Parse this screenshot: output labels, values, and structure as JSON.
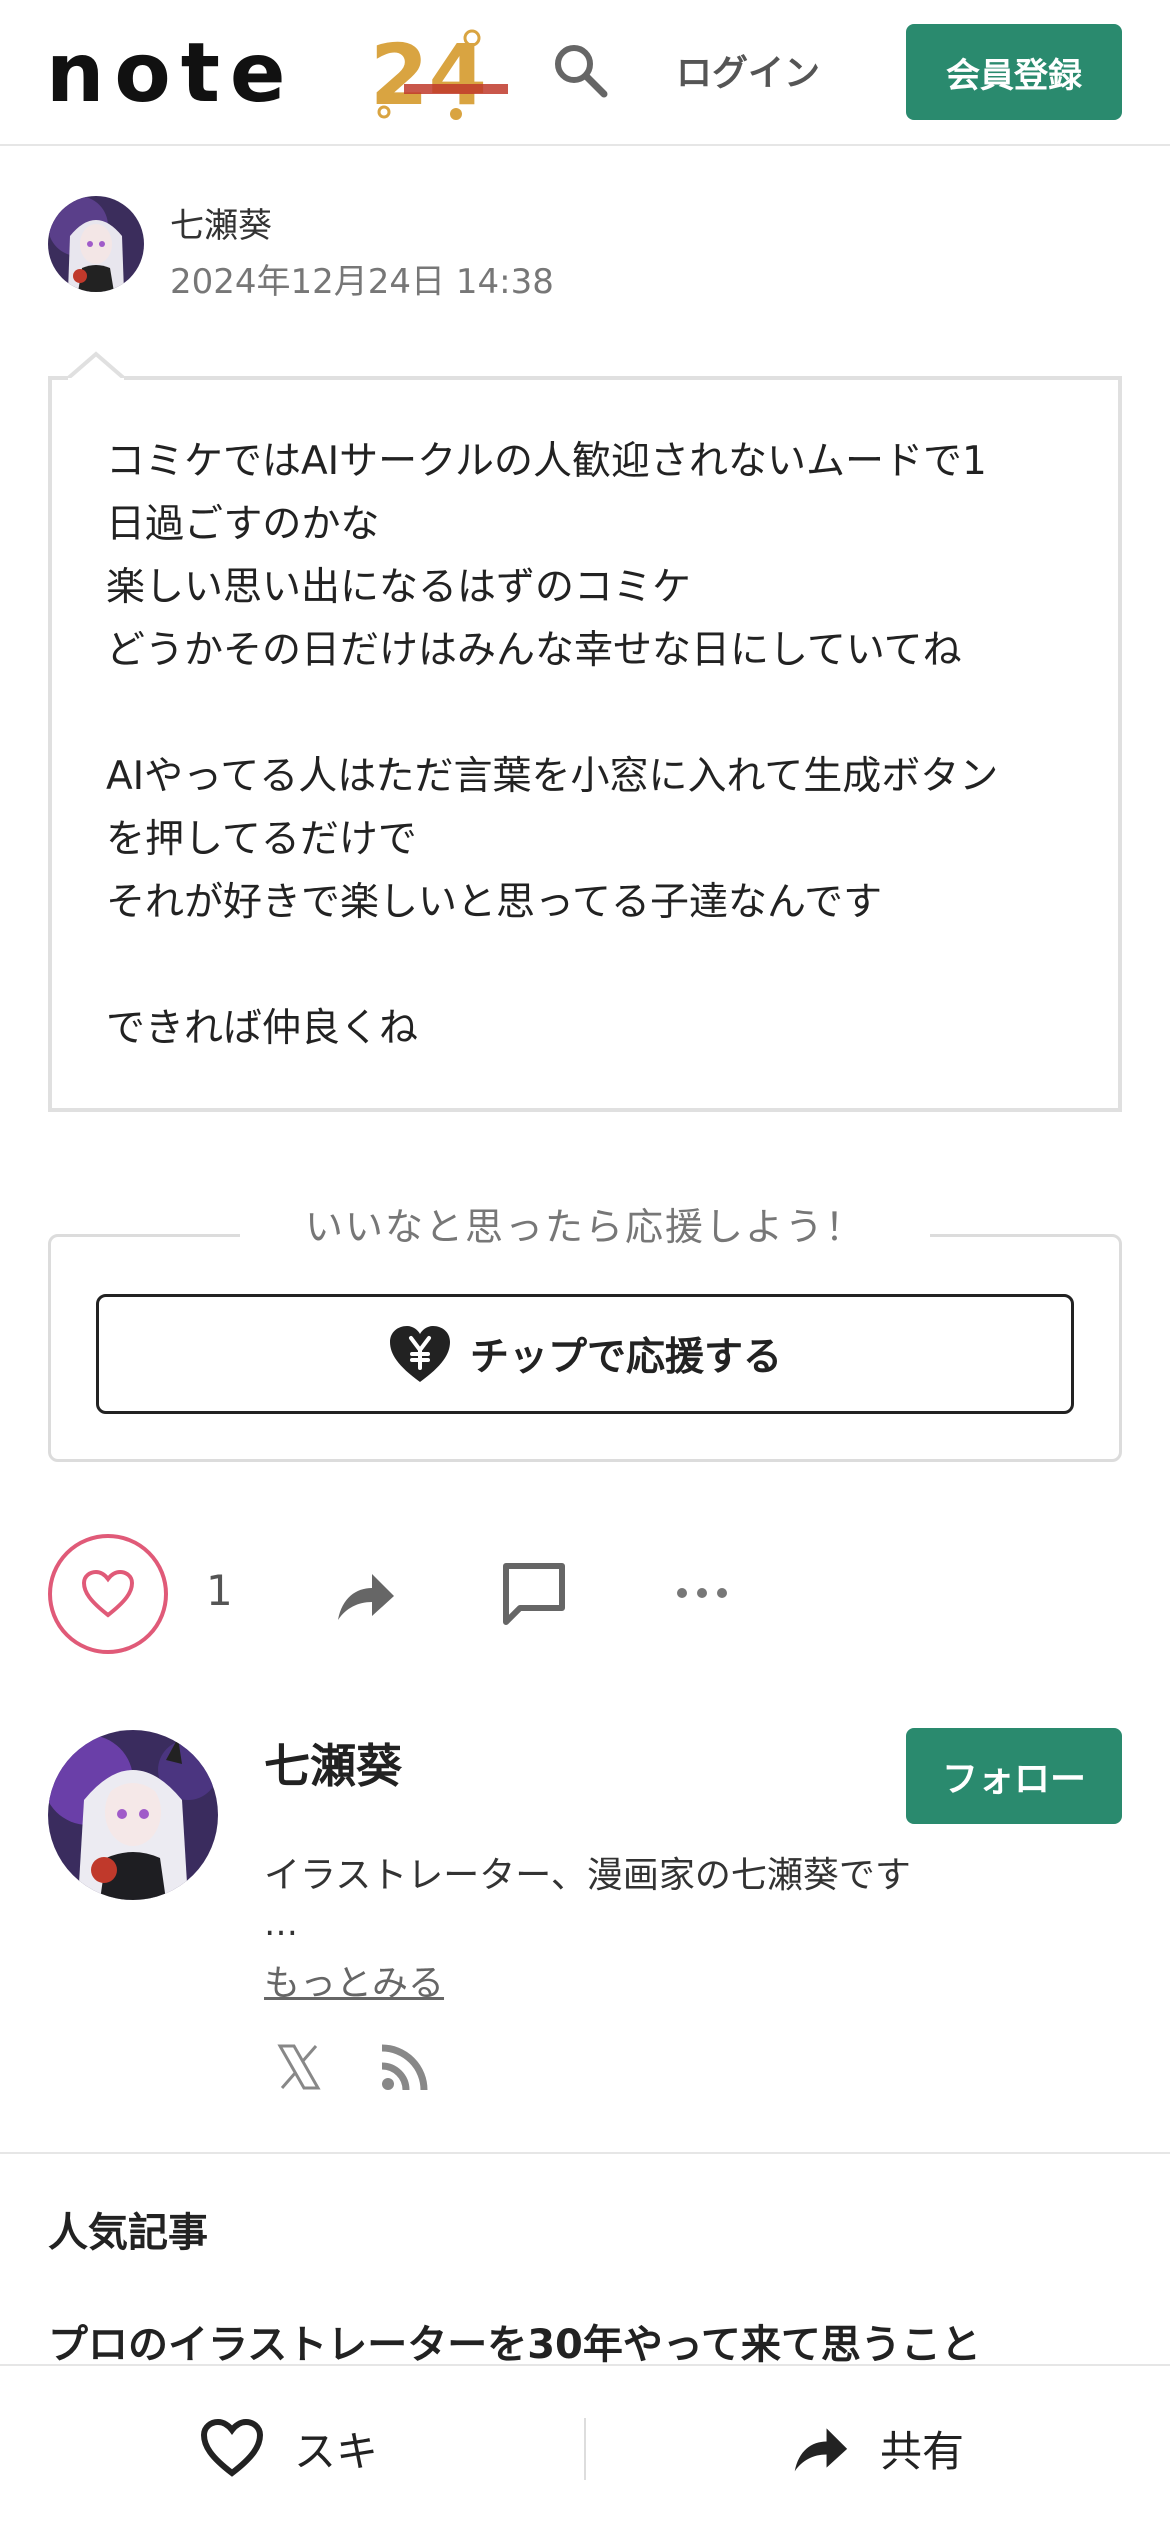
{
  "header": {
    "logo_text": "note",
    "logo_badge": "24",
    "login_label": "ログイン",
    "signup_label": "会員登録"
  },
  "post": {
    "author_name": "七瀬葵",
    "date": "2024年12月24日 14:38",
    "lines": [
      "コミケではAIサークルの人歓迎されないムードで1",
      "日過ごすのかな",
      "楽しい思い出になるはずのコミケ",
      "どうかその日だけはみんな幸せな日にしていてね",
      "",
      "AIやってる人はただ言葉を小窓に入れて生成ボタン",
      "を押してるだけで",
      "それが好きで楽しいと思ってる子達なんです",
      "",
      "できれば仲良くね"
    ]
  },
  "support": {
    "heading": "いいなと思ったら応援しよう！",
    "tip_label": "チップで応援する"
  },
  "actions": {
    "like_count": "1"
  },
  "profile": {
    "name": "七瀬葵",
    "follow_label": "フォロー",
    "bio": "イラストレーター、漫画家の七瀬葵です",
    "ellipsis": "…",
    "more_label": "もっとみる"
  },
  "popular": {
    "heading": "人気記事",
    "article_title": "プロのイラストレーターを30年やって来て思うこと"
  },
  "bottom_bar": {
    "like_label": "スキ",
    "share_label": "共有"
  },
  "colors": {
    "brand_green": "#2a8a6e",
    "like_pink": "#e05a78"
  }
}
